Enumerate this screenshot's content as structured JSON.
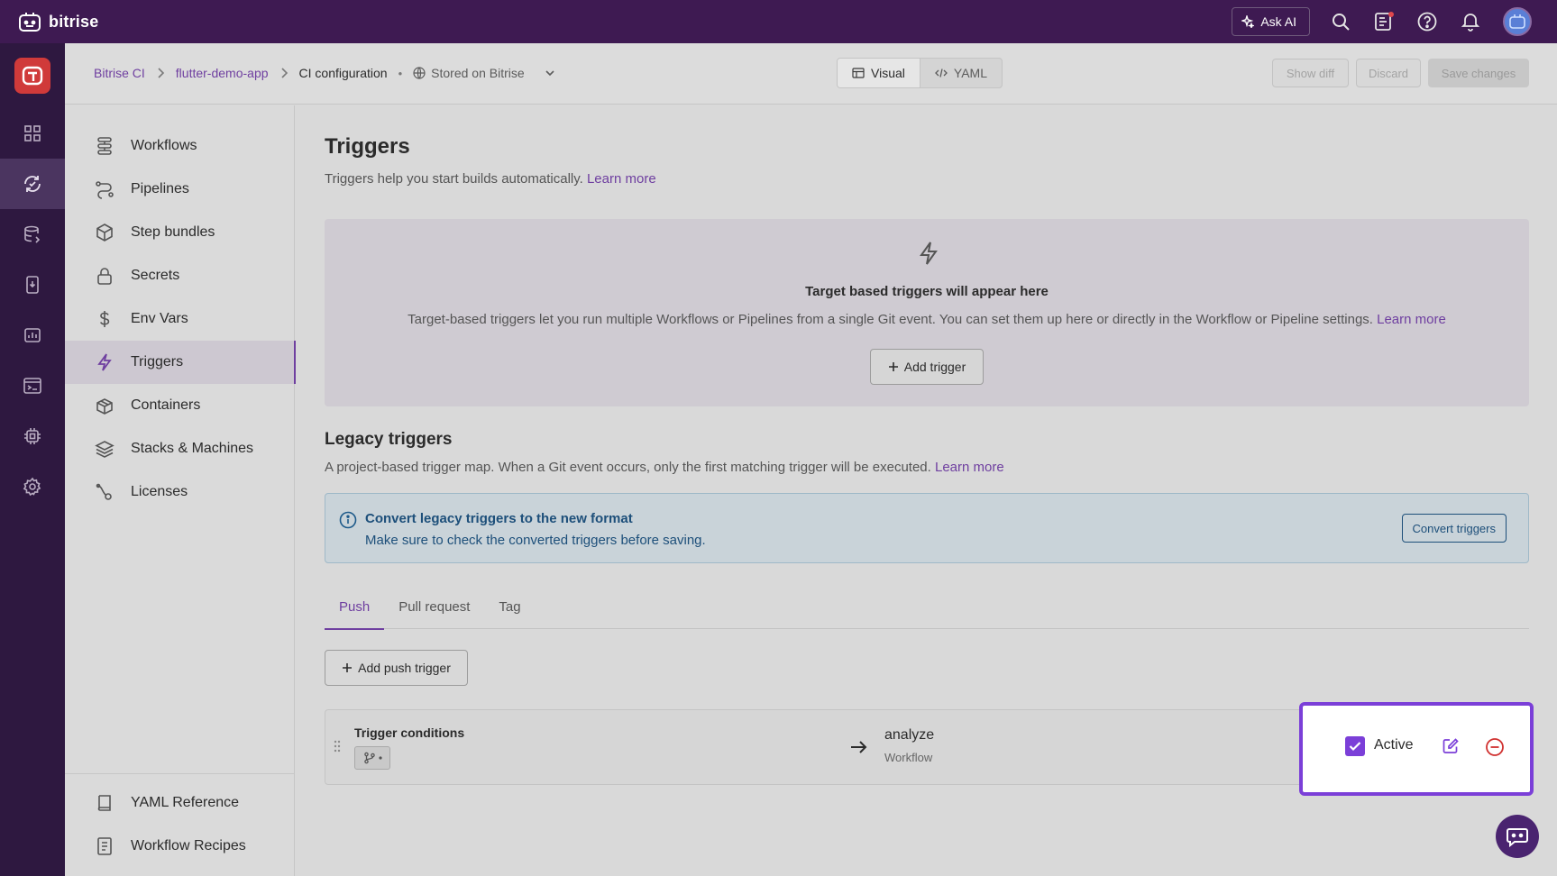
{
  "brand": {
    "name": "bitrise"
  },
  "topbar": {
    "ask_ai_label": "Ask AI"
  },
  "breadcrumb": {
    "items": [
      "Bitrise CI",
      "flutter-demo-app",
      "CI configuration"
    ],
    "separator": "•",
    "storage": "Stored on Bitrise"
  },
  "view_toggle": {
    "visual": "Visual",
    "yaml": "YAML"
  },
  "header_actions": {
    "show_diff": "Show diff",
    "discard": "Discard",
    "save": "Save changes"
  },
  "sidebar": {
    "items": [
      {
        "label": "Workflows",
        "icon": "workflows-icon"
      },
      {
        "label": "Pipelines",
        "icon": "pipelines-icon"
      },
      {
        "label": "Step bundles",
        "icon": "cube-icon"
      },
      {
        "label": "Secrets",
        "icon": "lock-icon"
      },
      {
        "label": "Env Vars",
        "icon": "dollar-icon"
      },
      {
        "label": "Triggers",
        "icon": "lightning-icon"
      },
      {
        "label": "Containers",
        "icon": "containers-icon"
      },
      {
        "label": "Stacks & Machines",
        "icon": "layers-icon"
      },
      {
        "label": "Licenses",
        "icon": "licenses-icon"
      }
    ],
    "footer": [
      {
        "label": "YAML Reference",
        "icon": "book-icon"
      },
      {
        "label": "Workflow Recipes",
        "icon": "document-icon"
      }
    ]
  },
  "main": {
    "title": "Triggers",
    "subtitle": "Triggers help you start builds automatically.",
    "learn_more": "Learn more",
    "empty_state": {
      "title": "Target based triggers will appear here",
      "description": "Target-based triggers let you run multiple Workflows or Pipelines from a single Git event. You can set them up here or directly in the Workflow or Pipeline settings.",
      "learn_more": "Learn more",
      "add_button": "Add trigger"
    },
    "legacy": {
      "title": "Legacy triggers",
      "subtitle": "A project-based trigger map. When a Git event occurs, only the first matching trigger will be executed.",
      "learn_more": "Learn more",
      "notice_title": "Convert legacy triggers to the new format",
      "notice_desc": "Make sure to check the converted triggers before saving.",
      "convert_button": "Convert triggers"
    },
    "tabs": [
      "Push",
      "Pull request",
      "Tag"
    ],
    "add_push_button": "Add push trigger",
    "trigger_row": {
      "conditions_label": "Trigger conditions",
      "workflow_name": "analyze",
      "workflow_type": "Workflow",
      "active_label": "Active",
      "active": true
    }
  },
  "colors": {
    "accent": "#6f3fa0",
    "topbar": "#3e1a52",
    "danger": "#d0302f",
    "info": "#1d4f7a"
  }
}
